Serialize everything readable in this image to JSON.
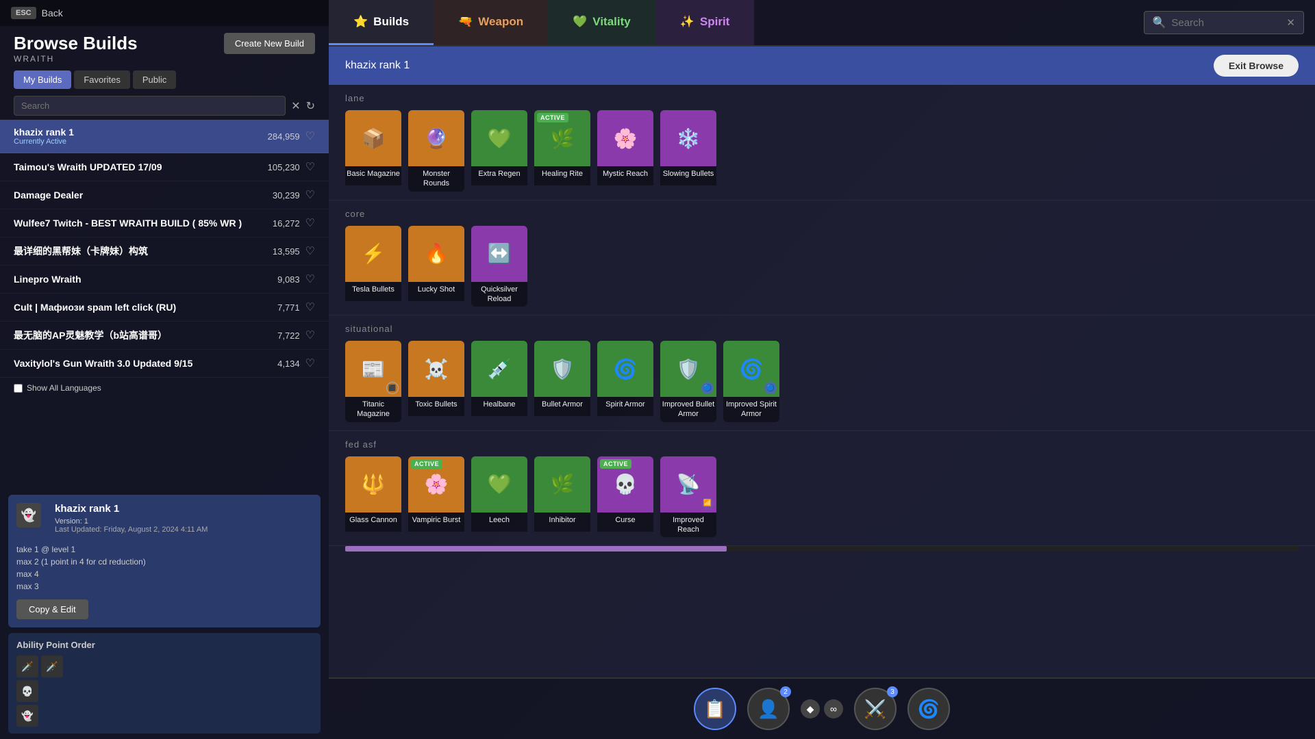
{
  "left_panel": {
    "esc_label": "ESC",
    "back_label": "Back",
    "browse_title": "Browse Builds",
    "browse_subtitle": "WRAITH",
    "create_btn": "Create New Build",
    "tabs": [
      {
        "id": "my-builds",
        "label": "My Builds",
        "active": true
      },
      {
        "id": "favorites",
        "label": "Favorites",
        "active": false
      },
      {
        "id": "public",
        "label": "Public",
        "active": false
      }
    ],
    "search_placeholder": "Search",
    "show_languages": "Show All Languages",
    "builds": [
      {
        "name": "khazix rank 1",
        "count": "284,959",
        "active": true,
        "active_label": "Currently Active"
      },
      {
        "name": "Taimou's Wraith UPDATED 17/09",
        "count": "105,230",
        "active": false
      },
      {
        "name": "Damage Dealer",
        "count": "30,239",
        "active": false
      },
      {
        "name": "Wulfee7 Twitch - BEST WRAITH BUILD ( 85% WR )",
        "count": "16,272",
        "active": false
      },
      {
        "name": "最详细的黑帮妹（卡牌妹）构筑",
        "count": "13,595",
        "active": false
      },
      {
        "name": "Linepro Wraith",
        "count": "9,083",
        "active": false
      },
      {
        "name": "Cult | Мафиози spam left click (RU)",
        "count": "7,771",
        "active": false
      },
      {
        "name": "最无脑的AP灵魅教学（b站高谱哥）",
        "count": "7,722",
        "active": false
      },
      {
        "name": "Vaxitylol's Gun Wraith 3.0 Updated 9/15",
        "count": "4,134",
        "active": false
      }
    ],
    "detail_card": {
      "title": "khazix rank 1",
      "icon": "👻",
      "version": "Version: 1",
      "last_updated": "Last Updated: Friday, August 2, 2024 4:11 AM",
      "notes": "take 1 @ level 1\nmax 2 (1 point in 4 for cd reduction)\nmax 4\nmax 3",
      "copy_btn": "Copy & Edit"
    },
    "ability_order": {
      "title": "Ability Point Order",
      "icons": [
        "🗡️",
        "🗡️",
        "💀",
        "👻"
      ]
    }
  },
  "right_panel": {
    "nav_tabs": [
      {
        "id": "builds",
        "label": "Builds",
        "icon": "⭐",
        "active": true
      },
      {
        "id": "weapon",
        "label": "Weapon",
        "icon": "🔫",
        "active": false
      },
      {
        "id": "vitality",
        "label": "Vitality",
        "icon": "💚",
        "active": false
      },
      {
        "id": "spirit",
        "label": "Spirit",
        "icon": "✨",
        "active": false
      }
    ],
    "search_placeholder": "Search",
    "build_header": "khazix rank 1",
    "exit_browse_btn": "Exit Browse",
    "sections": [
      {
        "id": "lane",
        "label": "lane",
        "items": [
          {
            "name": "Basic Magazine",
            "icon": "📦",
            "color": "orange",
            "active": false
          },
          {
            "name": "Monster Rounds",
            "icon": "🔮",
            "color": "orange",
            "active": false
          },
          {
            "name": "Extra Regen",
            "icon": "💚",
            "color": "green",
            "active": false
          },
          {
            "name": "Healing Rite",
            "icon": "🌿",
            "color": "green",
            "active": true
          },
          {
            "name": "Mystic Reach",
            "icon": "🌸",
            "color": "purple",
            "active": false
          },
          {
            "name": "Slowing Bullets",
            "icon": "❄️",
            "color": "purple",
            "active": false
          }
        ]
      },
      {
        "id": "core",
        "label": "core",
        "items": [
          {
            "name": "Tesla Bullets",
            "icon": "⚡",
            "color": "orange",
            "active": false
          },
          {
            "name": "Lucky Shot",
            "icon": "🔥",
            "color": "orange",
            "active": false
          },
          {
            "name": "Quicksilver Reload",
            "icon": "↔️",
            "color": "purple",
            "active": false
          }
        ]
      },
      {
        "id": "situational",
        "label": "situational",
        "items": [
          {
            "name": "Titanic Magazine",
            "icon": "📰",
            "color": "orange",
            "active": false,
            "shield": false
          },
          {
            "name": "Toxic Bullets",
            "icon": "☠️",
            "color": "orange",
            "active": false
          },
          {
            "name": "Healbane",
            "icon": "💉",
            "color": "green",
            "active": false
          },
          {
            "name": "Bullet Armor",
            "icon": "🛡️",
            "color": "green",
            "active": false
          },
          {
            "name": "Spirit Armor",
            "icon": "🌀",
            "color": "green",
            "active": false
          },
          {
            "name": "Improved Bullet Armor",
            "icon": "🛡️",
            "color": "green",
            "active": false,
            "shield": true
          },
          {
            "name": "Improved Spirit Armor",
            "icon": "🌀",
            "color": "green",
            "active": false,
            "shield": true
          }
        ]
      },
      {
        "id": "fed-asf",
        "label": "fed asf",
        "items": [
          {
            "name": "Glass Cannon",
            "icon": "🔱",
            "color": "orange",
            "active": false
          },
          {
            "name": "Vampiric Burst",
            "icon": "🌸",
            "color": "orange",
            "active": true
          },
          {
            "name": "Leech",
            "icon": "💚",
            "color": "green",
            "active": false
          },
          {
            "name": "Inhibitor",
            "icon": "🌿",
            "color": "green",
            "active": false
          },
          {
            "name": "Curse",
            "icon": "💀",
            "color": "purple",
            "active": true
          },
          {
            "name": "Improved Reach",
            "icon": "📡",
            "color": "purple",
            "active": false
          }
        ]
      }
    ],
    "bottom_icons": [
      {
        "icon": "📋",
        "active": true,
        "badge": null
      },
      {
        "icon": "👤",
        "active": false,
        "badge": "2"
      },
      {
        "icon": "⚔️",
        "active": false,
        "badge": "3"
      },
      {
        "icon": "🌀",
        "active": false,
        "badge": null
      }
    ],
    "bottom_symbols": [
      "◆",
      "∞"
    ]
  }
}
